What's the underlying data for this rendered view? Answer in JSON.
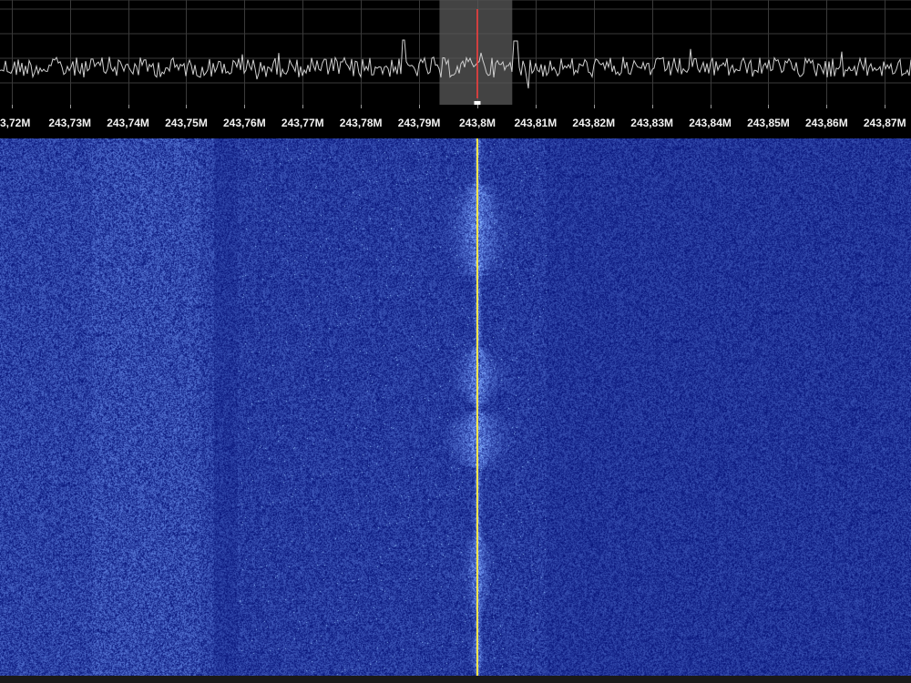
{
  "spectrum": {
    "center_frequency": "243,8M",
    "freq_start_mhz": 243.718,
    "freq_end_mhz": 243.8745,
    "filter_low_mhz": 243.7935,
    "filter_high_mhz": 243.806,
    "marker_color": "#ff3b3b",
    "trace_color": "#cfcfcf",
    "grid_color": "#3a3a3a",
    "filter_color": "#5a5a5a"
  },
  "axis": {
    "ticks": [
      {
        "mhz": 243.72,
        "label": "3,72M"
      },
      {
        "mhz": 243.73,
        "label": "243,73M"
      },
      {
        "mhz": 243.74,
        "label": "243,74M"
      },
      {
        "mhz": 243.75,
        "label": "243,75M"
      },
      {
        "mhz": 243.76,
        "label": "243,76M"
      },
      {
        "mhz": 243.77,
        "label": "243,77M"
      },
      {
        "mhz": 243.78,
        "label": "243,78M"
      },
      {
        "mhz": 243.79,
        "label": "243,79M"
      },
      {
        "mhz": 243.8,
        "label": "243,8M"
      },
      {
        "mhz": 243.81,
        "label": "243,81M"
      },
      {
        "mhz": 243.82,
        "label": "243,82M"
      },
      {
        "mhz": 243.83,
        "label": "243,83M"
      },
      {
        "mhz": 243.84,
        "label": "243,84M"
      },
      {
        "mhz": 243.85,
        "label": "243,85M"
      },
      {
        "mhz": 243.86,
        "label": "243,86M"
      },
      {
        "mhz": 243.87,
        "label": "243,87M"
      }
    ]
  },
  "waterfall": {
    "background_color": "#08158c",
    "cursor_color": "#ffe84a"
  }
}
